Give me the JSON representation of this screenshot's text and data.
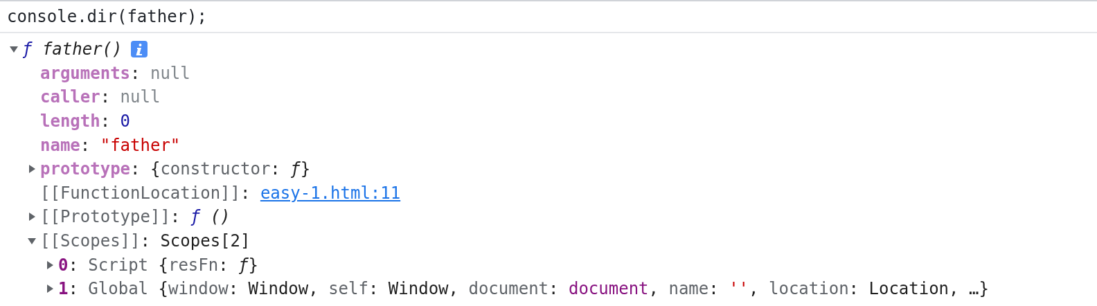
{
  "input": "console.dir(father);",
  "tree": {
    "expanded": true,
    "info_badge": true,
    "tokens": [
      {
        "kind": "fn",
        "text": "ƒ"
      },
      {
        "kind": "italic",
        "text": " father()"
      }
    ],
    "children": [
      {
        "tokens": [
          {
            "kind": "key",
            "text": "arguments"
          },
          {
            "kind": "punct",
            "text": ": "
          },
          {
            "kind": "null",
            "text": "null"
          }
        ]
      },
      {
        "tokens": [
          {
            "kind": "key",
            "text": "caller"
          },
          {
            "kind": "punct",
            "text": ": "
          },
          {
            "kind": "null",
            "text": "null"
          }
        ]
      },
      {
        "tokens": [
          {
            "kind": "key",
            "text": "length"
          },
          {
            "kind": "punct",
            "text": ": "
          },
          {
            "kind": "number",
            "text": "0"
          }
        ]
      },
      {
        "tokens": [
          {
            "kind": "key",
            "text": "name"
          },
          {
            "kind": "punct",
            "text": ": "
          },
          {
            "kind": "string",
            "text": "\"father\""
          }
        ]
      },
      {
        "expanded": false,
        "tokens": [
          {
            "kind": "key",
            "text": "prototype"
          },
          {
            "kind": "punct",
            "text": ": {"
          },
          {
            "kind": "dim",
            "text": "constructor"
          },
          {
            "kind": "punct",
            "text": ": "
          },
          {
            "kind": "fnplain",
            "text": "ƒ"
          },
          {
            "kind": "punct",
            "text": "}"
          }
        ]
      },
      {
        "tokens": [
          {
            "kind": "dim",
            "text": "[[FunctionLocation]]"
          },
          {
            "kind": "punct",
            "text": ": "
          },
          {
            "kind": "link",
            "text": "easy-1.html:11"
          }
        ]
      },
      {
        "expanded": false,
        "tokens": [
          {
            "kind": "dim",
            "text": "[[Prototype]]"
          },
          {
            "kind": "punct",
            "text": ": "
          },
          {
            "kind": "fn",
            "text": "ƒ"
          },
          {
            "kind": "italic",
            "text": " ()"
          }
        ]
      },
      {
        "expanded": true,
        "tokens": [
          {
            "kind": "dim",
            "text": "[[Scopes]]"
          },
          {
            "kind": "punct",
            "text": ": "
          },
          {
            "kind": "plain",
            "text": "Scopes[2]"
          }
        ],
        "children": [
          {
            "expanded": false,
            "tokens": [
              {
                "kind": "index",
                "text": "0"
              },
              {
                "kind": "punct",
                "text": ": "
              },
              {
                "kind": "dim",
                "text": "Script "
              },
              {
                "kind": "punct",
                "text": "{"
              },
              {
                "kind": "dim",
                "text": "resFn"
              },
              {
                "kind": "punct",
                "text": ": "
              },
              {
                "kind": "fnplain",
                "text": "ƒ"
              },
              {
                "kind": "punct",
                "text": "}"
              }
            ]
          },
          {
            "expanded": false,
            "tokens": [
              {
                "kind": "index",
                "text": "1"
              },
              {
                "kind": "punct",
                "text": ": "
              },
              {
                "kind": "dim",
                "text": "Global "
              },
              {
                "kind": "punct",
                "text": "{"
              },
              {
                "kind": "dim",
                "text": "window"
              },
              {
                "kind": "punct",
                "text": ": Window, "
              },
              {
                "kind": "dim",
                "text": "self"
              },
              {
                "kind": "punct",
                "text": ": Window, "
              },
              {
                "kind": "dim",
                "text": "document"
              },
              {
                "kind": "punct",
                "text": ": "
              },
              {
                "kind": "object",
                "text": "document"
              },
              {
                "kind": "punct",
                "text": ", "
              },
              {
                "kind": "dim",
                "text": "name"
              },
              {
                "kind": "punct",
                "text": ": "
              },
              {
                "kind": "string",
                "text": "''"
              },
              {
                "kind": "punct",
                "text": ", "
              },
              {
                "kind": "dim",
                "text": "location"
              },
              {
                "kind": "punct",
                "text": ": Location, …}"
              }
            ]
          }
        ]
      }
    ]
  }
}
